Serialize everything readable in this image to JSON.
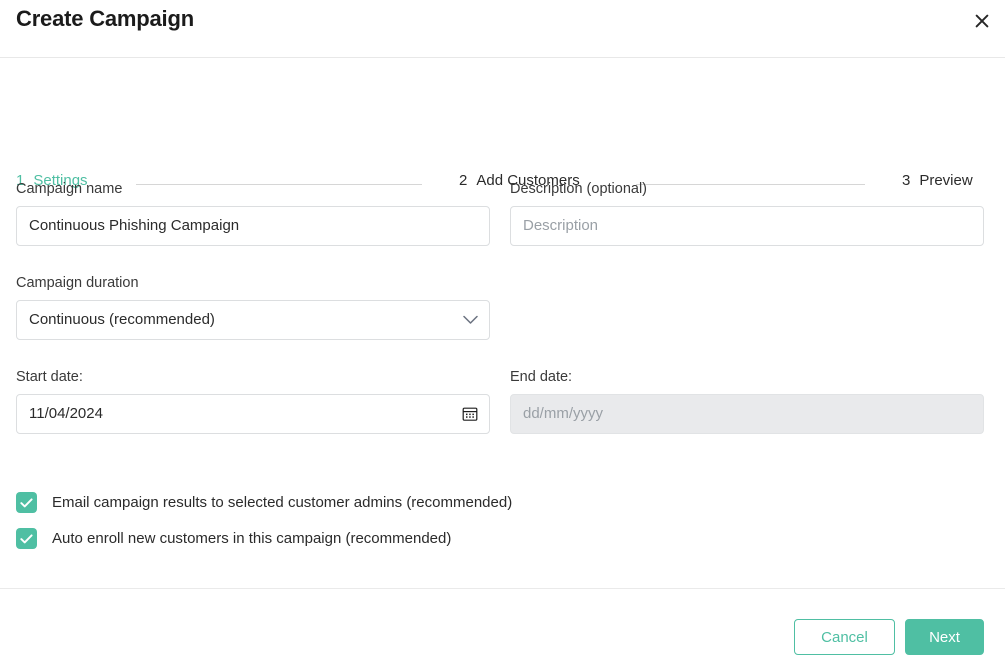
{
  "header": {
    "title": "Create Campaign",
    "close_icon": "close-icon"
  },
  "stepper": {
    "steps": [
      {
        "number": "1",
        "label": "Settings",
        "state": "active"
      },
      {
        "number": "2",
        "label": "Add Customers",
        "state": "inactive"
      },
      {
        "number": "3",
        "label": "Preview",
        "state": "inactive"
      }
    ]
  },
  "form": {
    "campaign_name": {
      "label": "Campaign name",
      "value": "Continuous Phishing Campaign",
      "placeholder": "Campaign name"
    },
    "description": {
      "label": "Description (optional)",
      "value": "",
      "placeholder": "Description"
    },
    "campaign_duration": {
      "label": "Campaign duration",
      "value": "Continuous (recommended)",
      "options": [
        "Continuous (recommended)"
      ],
      "chevron_icon": "chevron-down-icon"
    },
    "start_date": {
      "label": "Start date:",
      "value": "11/04/2024",
      "placeholder": "dd/mm/yyyy",
      "calendar_icon": "calendar-icon"
    },
    "end_date": {
      "label": "End date:",
      "value": "",
      "placeholder": "dd/mm/yyyy",
      "disabled": true
    },
    "checkboxes": [
      {
        "label": "Email campaign results to selected customer admins (recommended)",
        "checked": true
      },
      {
        "label": "Auto enroll new customers in this campaign (recommended)",
        "checked": true
      }
    ]
  },
  "footer": {
    "cancel_label": "Cancel",
    "next_label": "Next"
  },
  "colors": {
    "accent": "#4fbfa3",
    "text": "#2b2b2b",
    "muted": "#9aa0a6",
    "border": "#dcdee0",
    "disabled_bg": "#e9eaec"
  }
}
